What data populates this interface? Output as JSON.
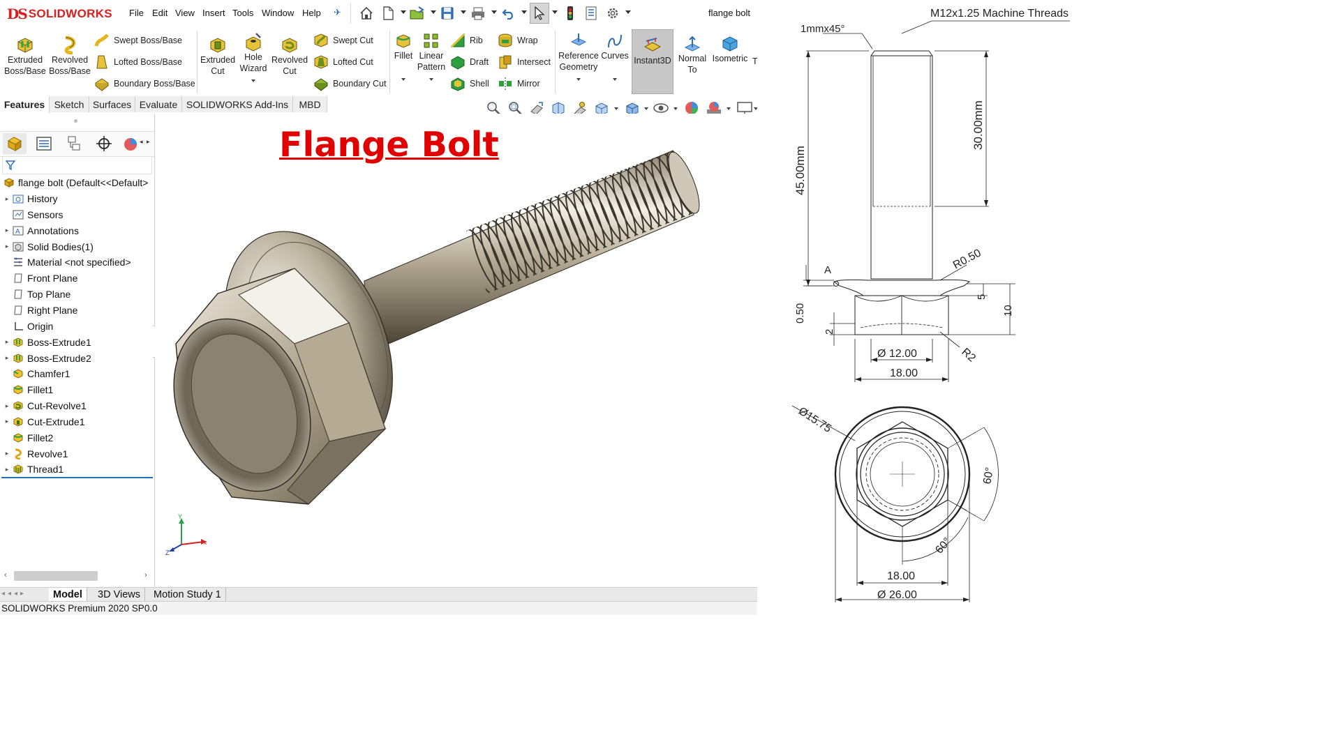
{
  "app": {
    "brand": "SOLIDWORKS",
    "brand_mark": "DS",
    "document_title": "flange bolt"
  },
  "menu": [
    "File",
    "Edit",
    "View",
    "Insert",
    "Tools",
    "Window",
    "Help"
  ],
  "quick_access_icons": [
    "home-icon",
    "new-document-icon",
    "open-icon",
    "save-icon",
    "print-icon",
    "undo-icon",
    "select-icon",
    "rebuild-icon",
    "file-properties-icon",
    "options-icon"
  ],
  "features_toolbar": {
    "extruded_boss": "Extruded Boss/Base",
    "extruded_boss_l1": "Extruded",
    "extruded_boss_l2": "Boss/Base",
    "revolved_boss_l1": "Revolved",
    "revolved_boss_l2": "Boss/Base",
    "swept_boss": "Swept Boss/Base",
    "lofted_boss": "Lofted Boss/Base",
    "boundary_boss": "Boundary Boss/Base",
    "extruded_cut_l1": "Extruded",
    "extruded_cut_l2": "Cut",
    "hole_wizard_l1": "Hole",
    "hole_wizard_l2": "Wizard",
    "revolved_cut_l1": "Revolved",
    "revolved_cut_l2": "Cut",
    "swept_cut": "Swept Cut",
    "lofted_cut": "Lofted Cut",
    "boundary_cut": "Boundary Cut",
    "fillet": "Fillet",
    "linear_pattern_l1": "Linear",
    "linear_pattern_l2": "Pattern",
    "rib": "Rib",
    "draft": "Draft",
    "shell": "Shell",
    "wrap": "Wrap",
    "intersect": "Intersect",
    "mirror": "Mirror",
    "reference_geometry_l1": "Reference",
    "reference_geometry_l2": "Geometry",
    "curves": "Curves",
    "instant3d": "Instant3D",
    "normal_to_l1": "Normal",
    "normal_to_l2": "To",
    "isometric": "Isometric",
    "overflow": "T"
  },
  "tabs": [
    "Features",
    "Sketch",
    "Surfaces",
    "Evaluate",
    "SOLIDWORKS Add-Ins",
    "MBD"
  ],
  "active_tab": "Features",
  "feature_tree": {
    "root": "flange bolt  (Default<<Default>",
    "items": [
      {
        "label": "History",
        "icon": "history-folder-icon",
        "expandable": true
      },
      {
        "label": "Sensors",
        "icon": "sensors-icon",
        "expandable": false
      },
      {
        "label": "Annotations",
        "icon": "annotations-icon",
        "expandable": true
      },
      {
        "label": "Solid Bodies(1)",
        "icon": "solid-bodies-icon",
        "expandable": true
      },
      {
        "label": "Material <not specified>",
        "icon": "material-icon",
        "expandable": false
      },
      {
        "label": "Front Plane",
        "icon": "plane-icon",
        "expandable": false
      },
      {
        "label": "Top Plane",
        "icon": "plane-icon",
        "expandable": false
      },
      {
        "label": "Right Plane",
        "icon": "plane-icon",
        "expandable": false
      },
      {
        "label": "Origin",
        "icon": "origin-icon",
        "expandable": false
      },
      {
        "label": "Boss-Extrude1",
        "icon": "boss-extrude-icon",
        "expandable": true
      },
      {
        "label": "Boss-Extrude2",
        "icon": "boss-extrude-icon",
        "expandable": true
      },
      {
        "label": "Chamfer1",
        "icon": "chamfer-icon",
        "expandable": false
      },
      {
        "label": "Fillet1",
        "icon": "fillet-icon",
        "expandable": false
      },
      {
        "label": "Cut-Revolve1",
        "icon": "cut-revolve-icon",
        "expandable": true
      },
      {
        "label": "Cut-Extrude1",
        "icon": "cut-extrude-icon",
        "expandable": true
      },
      {
        "label": "Fillet2",
        "icon": "fillet-icon",
        "expandable": false
      },
      {
        "label": "Revolve1",
        "icon": "revolve-icon",
        "expandable": true
      },
      {
        "label": "Thread1",
        "icon": "thread-icon",
        "expandable": true
      }
    ]
  },
  "viewport": {
    "title": "Flange Bolt",
    "triad": {
      "x": "x",
      "y": "Y",
      "z": "Z"
    }
  },
  "bottom_tabs": [
    "Model",
    "3D Views",
    "Motion Study 1"
  ],
  "active_bottom_tab": "Model",
  "status_bar": "SOLIDWORKS Premium 2020 SP0.0",
  "drawing": {
    "thread_note": "M12x1.25 Machine Threads",
    "chamfer_note": "1mmx45°",
    "overall_length": "45.00mm",
    "thread_length": "30.00mm",
    "fillet_radius": "R0.50",
    "datum": "A",
    "flange_thickness": "0.50",
    "dim_5": "5",
    "dim_10": "10",
    "dim_2": "2",
    "shank_diameter": "Ø 12.00",
    "hex_width_side": "18.00",
    "radius_r2": "R2",
    "face_diameter": "Ø15.75",
    "angle_top": "60°",
    "angle_bottom": "60°",
    "hex_width_top": "18.00",
    "flange_diameter": "Ø 26.00"
  },
  "colors": {
    "brand_red": "#d91e1e",
    "title_red": "#e00000",
    "instant3d_active": "#c7c7c7",
    "selection_blue": "#1f6fb5"
  }
}
